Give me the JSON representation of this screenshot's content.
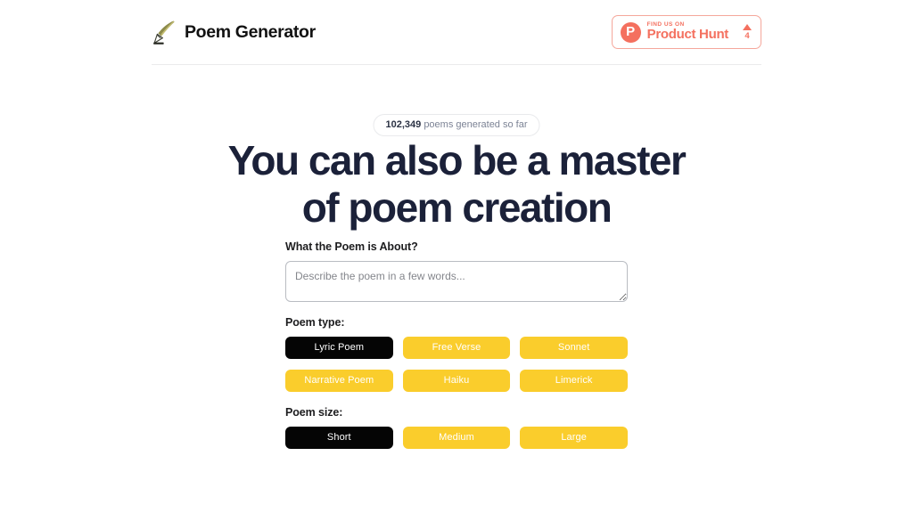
{
  "header": {
    "brand_name": "Poem Generator",
    "logo_icon": "quill-pen-icon",
    "product_hunt": {
      "kicker": "FIND US ON",
      "name": "Product Hunt",
      "logo_letter": "P",
      "vote_count": "4",
      "upvote_icon": "triangle-up-icon",
      "accent_color": "#f4705f"
    }
  },
  "counter": {
    "number": "102,349",
    "suffix": " poems generated so far"
  },
  "headline": {
    "line1": "You can also be a master",
    "line2": "of poem creation"
  },
  "form": {
    "topic": {
      "label": "What the Poem is About?",
      "placeholder": "Describe the poem in a few words...",
      "value": ""
    },
    "poem_type": {
      "label": "Poem type:",
      "selected": "Lyric Poem",
      "options": [
        {
          "label": "Lyric Poem",
          "selected": true
        },
        {
          "label": "Free Verse",
          "selected": false
        },
        {
          "label": "Sonnet",
          "selected": false
        },
        {
          "label": "Narrative Poem",
          "selected": false
        },
        {
          "label": "Haiku",
          "selected": false
        },
        {
          "label": "Limerick",
          "selected": false
        }
      ]
    },
    "poem_size": {
      "label": "Poem size:",
      "selected": "Short",
      "options": [
        {
          "label": "Short",
          "selected": true
        },
        {
          "label": "Medium",
          "selected": false
        },
        {
          "label": "Large",
          "selected": false
        }
      ]
    }
  },
  "colors": {
    "accent_yellow": "#facd2c",
    "selected_black": "#050505",
    "headline_navy": "#1b2139",
    "product_hunt_coral": "#f4705f"
  }
}
